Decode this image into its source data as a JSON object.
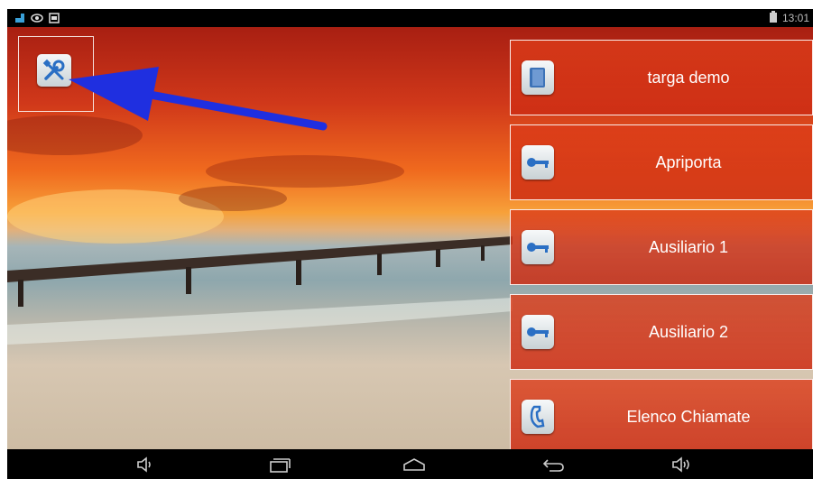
{
  "status_bar": {
    "left_icons": [
      "android-notification-icon",
      "eye-icon",
      "screenshot-icon"
    ],
    "right_icons": [
      "battery-icon"
    ],
    "time": "13:01"
  },
  "settings": {
    "icon": "tools-icon"
  },
  "buttons": [
    {
      "label": "targa demo",
      "icon": "book-icon"
    },
    {
      "label": "Apriporta",
      "icon": "key-icon"
    },
    {
      "label": "Ausiliario 1",
      "icon": "key-icon"
    },
    {
      "label": "Ausiliario 2",
      "icon": "key-icon"
    },
    {
      "label": "Elenco Chiamate",
      "icon": "phone-icon"
    }
  ],
  "nav_bar": [
    "volume-down-icon",
    "recent-apps-icon",
    "home-icon",
    "back-icon",
    "volume-up-icon"
  ],
  "colors": {
    "button_bg": "#d63c19",
    "arrow": "#1f2fe0",
    "icon_blue": "#2a6fc4"
  }
}
